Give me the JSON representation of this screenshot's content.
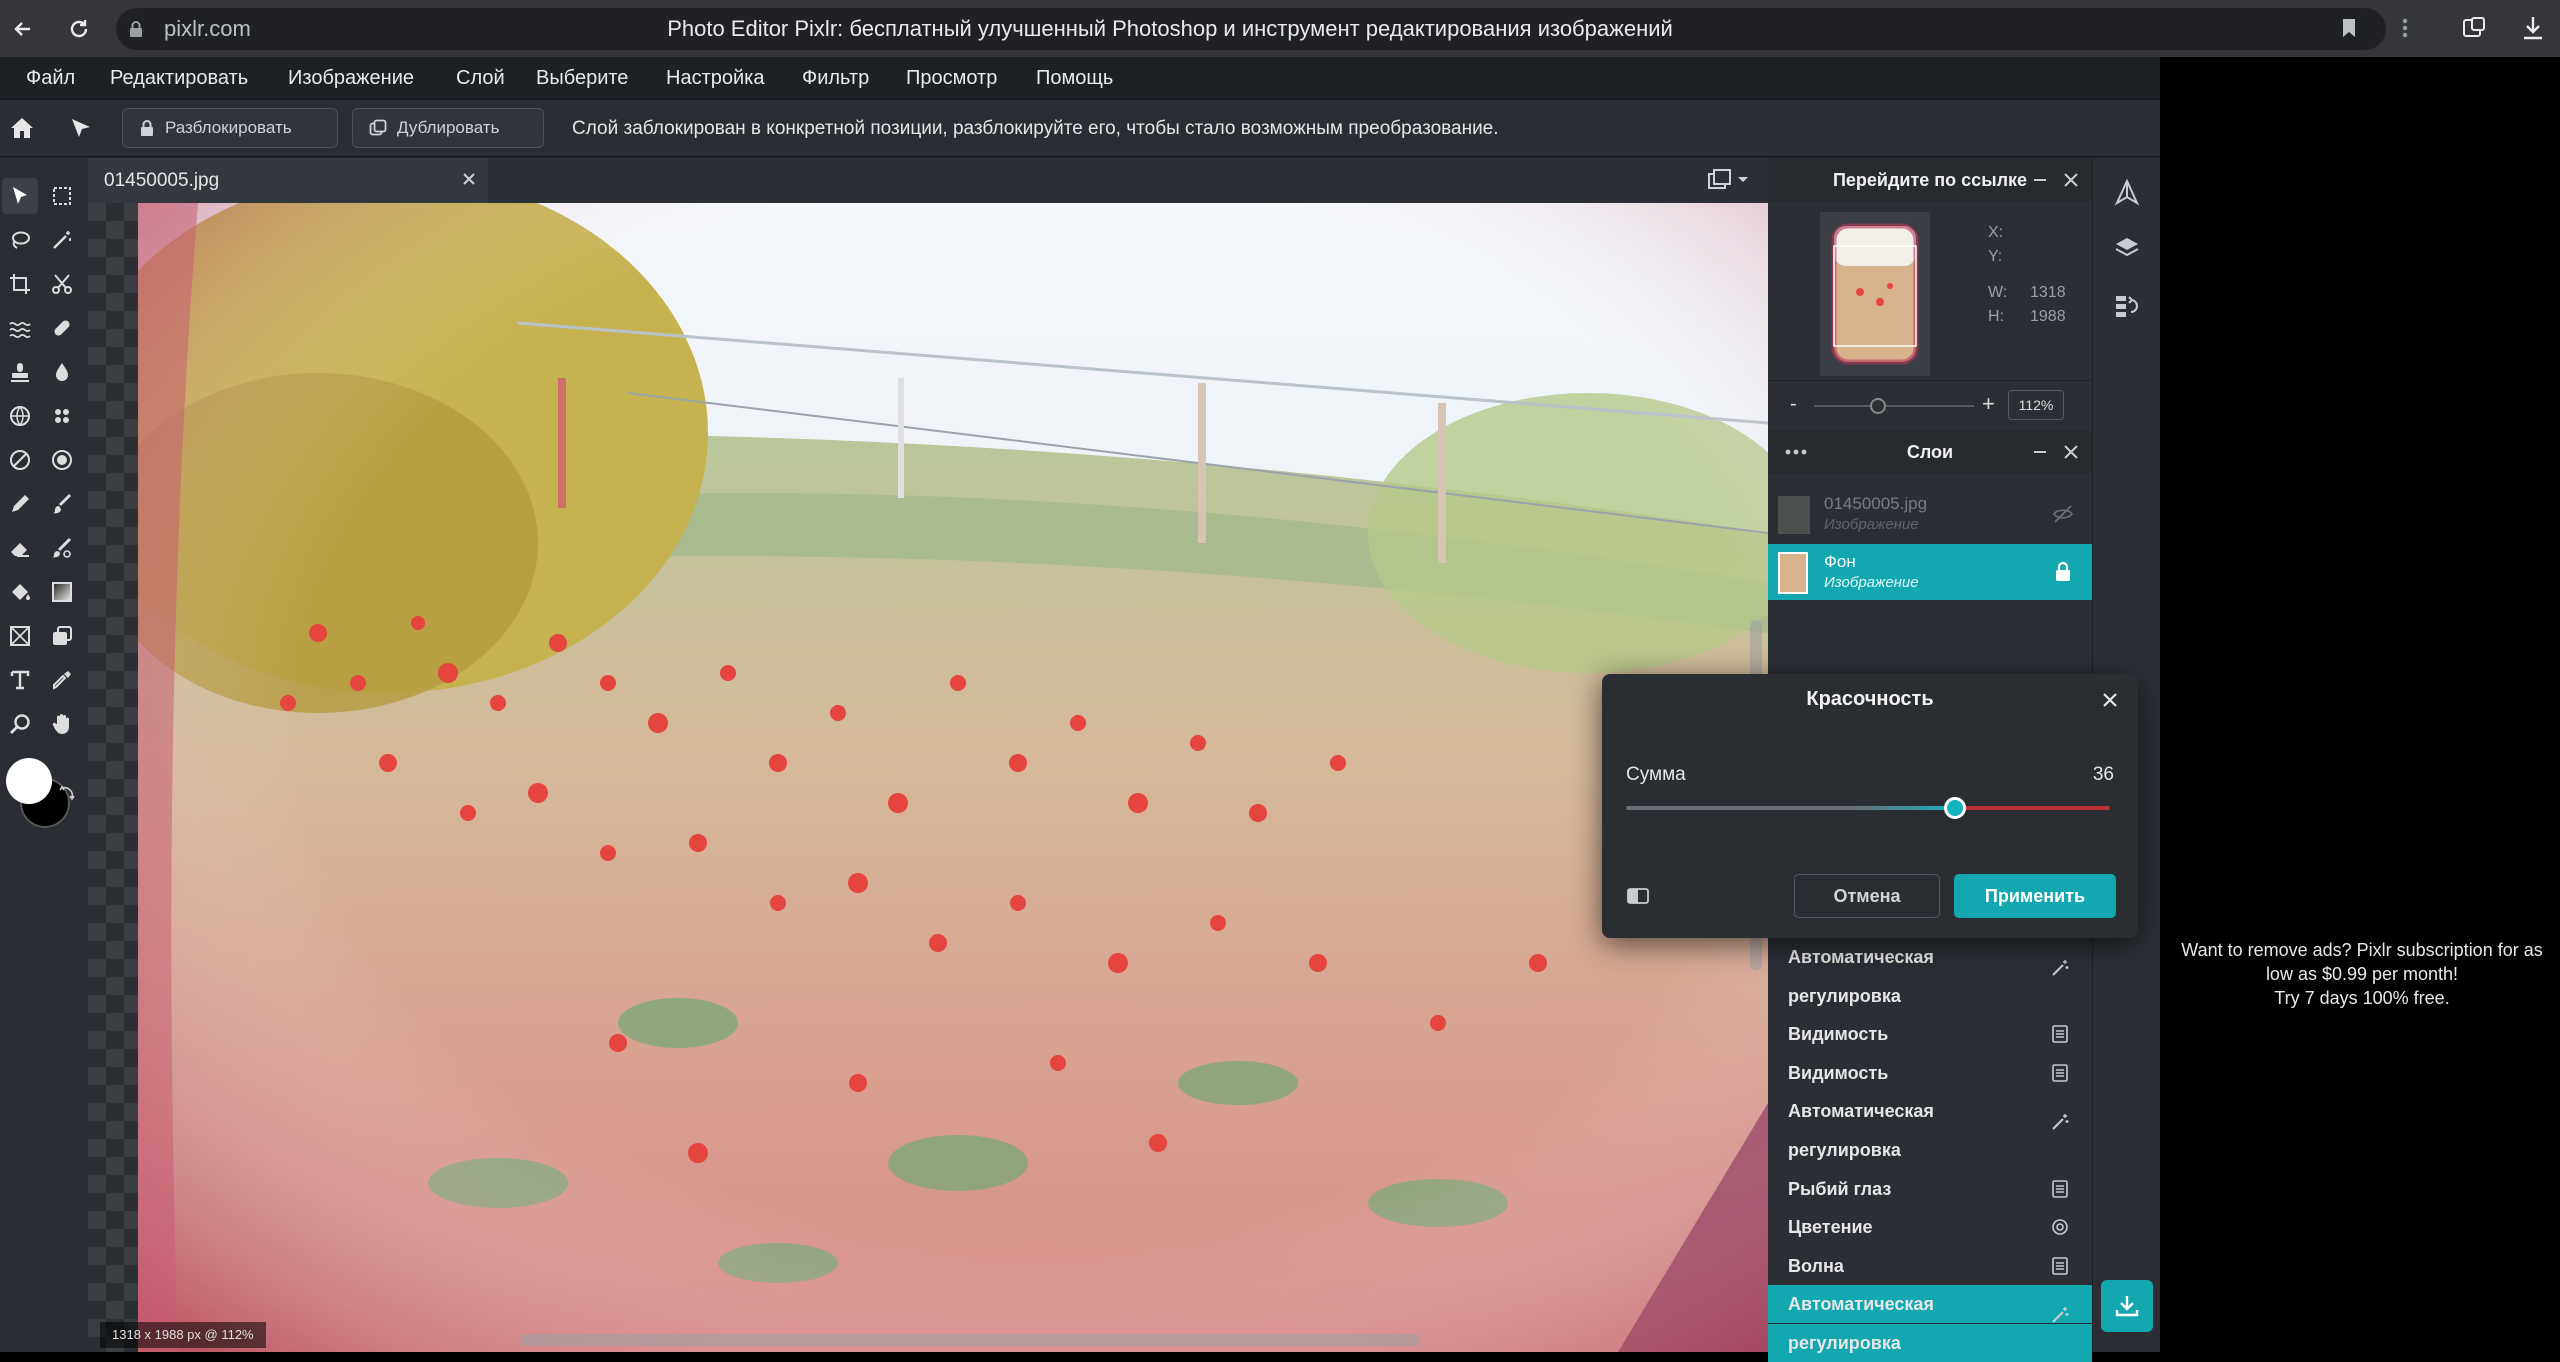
{
  "browser": {
    "url": "pixlr.com",
    "page_title": "Photo Editor Pixlr: бесплатный улучшенный Photoshop и инструмент редактирования изображений"
  },
  "menu": {
    "items": [
      "Файл",
      "Редактировать",
      "Изображение",
      "Слой",
      "Выберите",
      "Настройка",
      "Фильтр",
      "Просмотр",
      "Помощь"
    ]
  },
  "options": {
    "unlock_label": "Разблокировать",
    "duplicate_label": "Дублировать",
    "lock_message": "Слой заблокирован в конкретной позиции, разблокируйте его, чтобы стало возможным преобразование."
  },
  "document": {
    "tab_name": "01450005.jpg",
    "status": "1318 x 1988 px @ 112%"
  },
  "navigator": {
    "title": "Перейдите по ссылке",
    "x_label": "X:",
    "y_label": "Y:",
    "w_label": "W:",
    "w_value": "1318",
    "h_label": "H:",
    "h_value": "1988",
    "zoom_minus": "-",
    "zoom_plus": "+",
    "zoom_value": "112%",
    "zoom_level": 0.4
  },
  "layers": {
    "title": "Слои",
    "items": [
      {
        "name": "01450005.jpg",
        "type": "Изображение"
      },
      {
        "name": "Фон",
        "type": "Изображение"
      }
    ]
  },
  "history": {
    "items": [
      {
        "label": "Автоматическая",
        "icon": "magic-wand-icon"
      },
      {
        "label": "регулировка",
        "icon": ""
      },
      {
        "label": "Видимость",
        "icon": "document-icon"
      },
      {
        "label": "Видимость",
        "icon": "document-icon"
      },
      {
        "label": "Автоматическая",
        "icon": "magic-wand-icon"
      },
      {
        "label": "регулировка",
        "icon": ""
      },
      {
        "label": "Рыбий глаз",
        "icon": "document-icon"
      },
      {
        "label": "Цветение",
        "icon": "gear-icon"
      },
      {
        "label": "Волна",
        "icon": "document-icon"
      },
      {
        "label": "Автоматическая",
        "icon": "magic-wand-icon"
      },
      {
        "label": "регулировка",
        "icon": ""
      }
    ]
  },
  "dialog": {
    "title": "Красочность",
    "amount_label": "Сумма",
    "amount_value": "36",
    "slider_fraction": 0.68,
    "cancel_label": "Отмена",
    "apply_label": "Применить"
  },
  "ad": {
    "line1": "Want to remove ads? Pixlr subscription for as",
    "line2": "low as $0.99 per month!",
    "line3": "Try 7 days 100% free."
  },
  "colors": {
    "accent": "#13a8b0",
    "panel": "#2b2f35"
  }
}
